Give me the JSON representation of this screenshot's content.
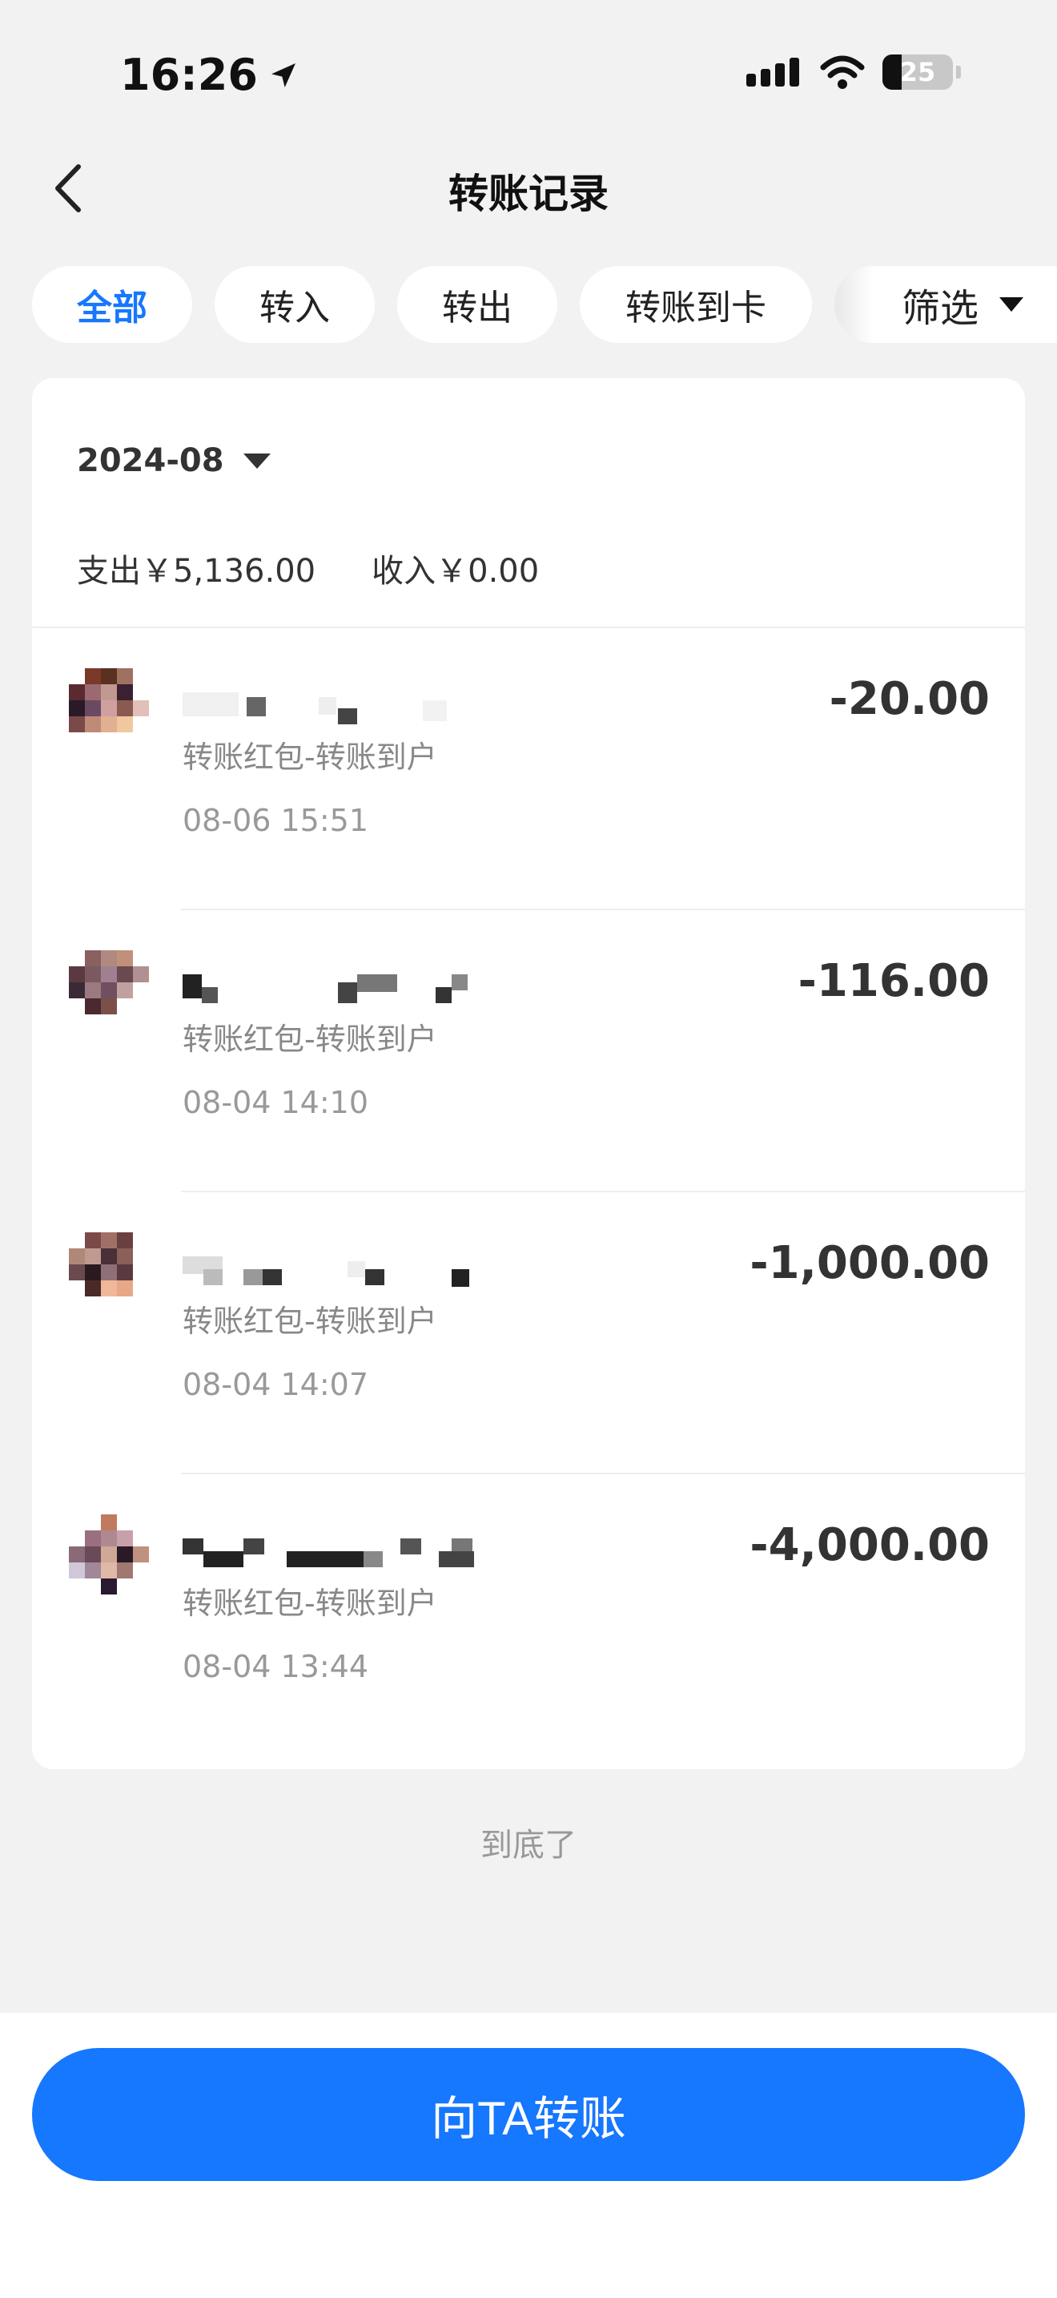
{
  "status": {
    "time": "16:26",
    "battery": "25"
  },
  "header": {
    "title": "转账记录"
  },
  "filters": {
    "tabs": [
      {
        "label": "全部",
        "active": true
      },
      {
        "label": "转入",
        "active": false
      },
      {
        "label": "转出",
        "active": false
      },
      {
        "label": "转账到卡",
        "active": false
      }
    ],
    "filter_label": "筛选"
  },
  "summary": {
    "month": "2024-08",
    "expense": "支出￥5,136.00",
    "income": "收入￥0.00"
  },
  "transactions": [
    {
      "desc": "转账红包-转账到户",
      "time": "08-06 15:51",
      "amount": "-20.00"
    },
    {
      "desc": "转账红包-转账到户",
      "time": "08-04 14:10",
      "amount": "-116.00"
    },
    {
      "desc": "转账红包-转账到户",
      "time": "08-04 14:07",
      "amount": "-1,000.00"
    },
    {
      "desc": "转账红包-转账到户",
      "time": "08-04 13:44",
      "amount": "-4,000.00"
    }
  ],
  "footer_text": "到底了",
  "bottom": {
    "button_label": "向TA转账"
  },
  "colors": {
    "accent": "#1677ff",
    "background": "#f2f2f2"
  }
}
